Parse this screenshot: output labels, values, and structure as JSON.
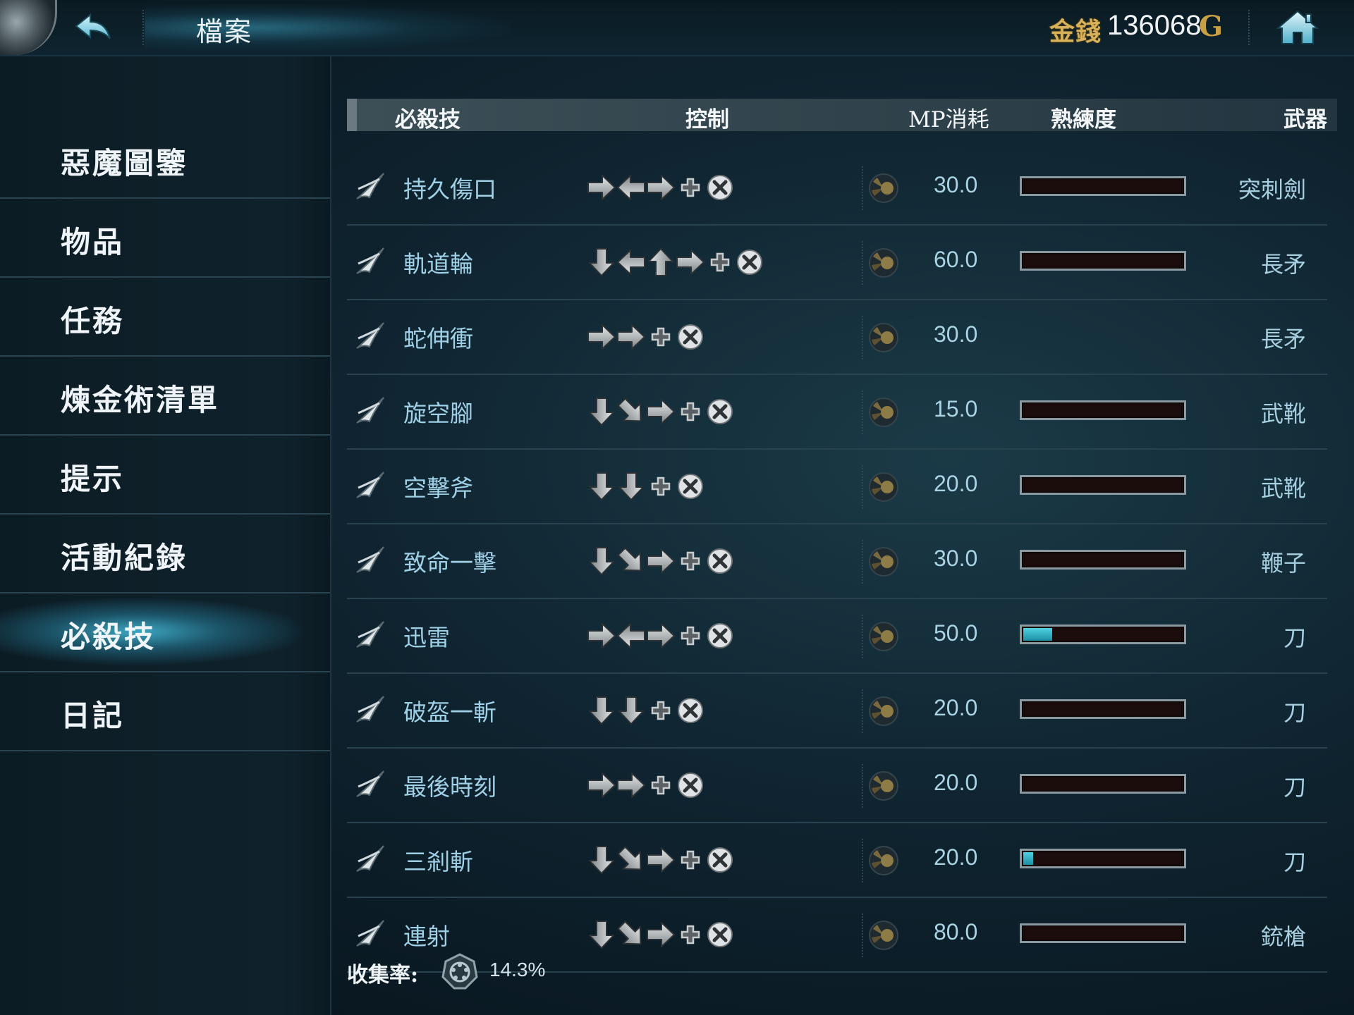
{
  "header": {
    "title": "檔案",
    "money_label": "金錢",
    "money_value": "136068",
    "money_unit": "G",
    "back_icon": "back-arrow-icon",
    "home_icon": "home-icon"
  },
  "sidebar": {
    "items": [
      {
        "label": "惡魔圖鑒",
        "active": false
      },
      {
        "label": "物品",
        "active": false
      },
      {
        "label": "任務",
        "active": false
      },
      {
        "label": "煉金術清單",
        "active": false
      },
      {
        "label": "提示",
        "active": false
      },
      {
        "label": "活動紀錄",
        "active": false
      },
      {
        "label": "必殺技",
        "active": true
      },
      {
        "label": "日記",
        "active": false
      }
    ]
  },
  "table": {
    "headers": {
      "skill": "必殺技",
      "control": "控制",
      "mp": "MP消耗",
      "proficiency": "熟練度",
      "weapon": "武器"
    },
    "rows": [
      {
        "name": "持久傷口",
        "inputs": [
          "right",
          "left",
          "right",
          "plus",
          "button"
        ],
        "mp": "30.0",
        "proficiency": 0,
        "weapon": "突刺劍",
        "icon": "slash-icon"
      },
      {
        "name": "軌道輪",
        "inputs": [
          "down",
          "left",
          "up",
          "right",
          "plus",
          "button"
        ],
        "mp": "60.0",
        "proficiency": 0,
        "weapon": "長矛",
        "icon": "orbit-icon"
      },
      {
        "name": "蛇伸衝",
        "inputs": [
          "right",
          "right",
          "plus",
          "button"
        ],
        "mp": "30.0",
        "proficiency": null,
        "weapon": "長矛",
        "icon": "serpent-icon"
      },
      {
        "name": "旋空腳",
        "inputs": [
          "down",
          "down-right",
          "right",
          "plus",
          "button"
        ],
        "mp": "15.0",
        "proficiency": 0,
        "weapon": "武靴",
        "icon": "spin-kick-icon"
      },
      {
        "name": "空擊斧",
        "inputs": [
          "down",
          "down",
          "plus",
          "button"
        ],
        "mp": "20.0",
        "proficiency": 0,
        "weapon": "武靴",
        "icon": "axe-kick-icon"
      },
      {
        "name": "致命一擊",
        "inputs": [
          "down",
          "down-right",
          "right",
          "plus",
          "button"
        ],
        "mp": "30.0",
        "proficiency": 0,
        "weapon": "鞭子",
        "icon": "whip-icon"
      },
      {
        "name": "迅雷",
        "inputs": [
          "right",
          "left",
          "right",
          "plus",
          "button"
        ],
        "mp": "50.0",
        "proficiency": 0.18,
        "weapon": "刀",
        "icon": "thunder-icon"
      },
      {
        "name": "破盔一斬",
        "inputs": [
          "down",
          "down",
          "plus",
          "button"
        ],
        "mp": "20.0",
        "proficiency": 0,
        "weapon": "刀",
        "icon": "helm-splitter-icon"
      },
      {
        "name": "最後時刻",
        "inputs": [
          "right",
          "right",
          "plus",
          "button"
        ],
        "mp": "20.0",
        "proficiency": 0,
        "weapon": "刀",
        "icon": "crescent-icon"
      },
      {
        "name": "三剎斬",
        "inputs": [
          "down",
          "down-right",
          "right",
          "plus",
          "button"
        ],
        "mp": "20.0",
        "proficiency": 0.06,
        "weapon": "刀",
        "icon": "triple-slash-icon"
      },
      {
        "name": "連射",
        "inputs": [
          "down",
          "down-right",
          "right",
          "plus",
          "button"
        ],
        "mp": "80.0",
        "proficiency": 0,
        "weapon": "銃槍",
        "icon": "rapid-fire-icon"
      }
    ]
  },
  "footer": {
    "collection_label": "收集率:",
    "collection_value": "14.3%",
    "collection_icon": "collection-medal-icon"
  },
  "colors": {
    "accent": "#2fb6d0",
    "gold": "#d7b05a",
    "skill_text": "#9fd0e6"
  }
}
